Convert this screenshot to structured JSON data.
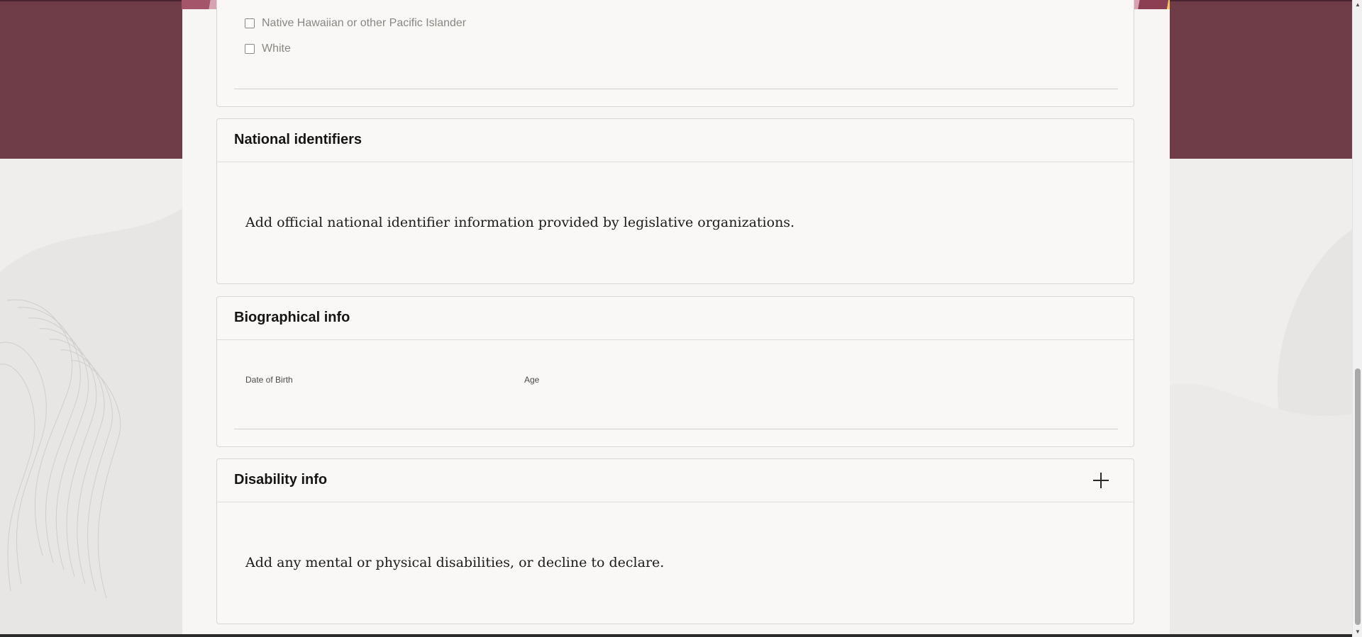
{
  "race_options": [
    {
      "label": "Native Hawaiian or other Pacific Islander",
      "checked": false
    },
    {
      "label": "White",
      "checked": false
    }
  ],
  "national_identifiers": {
    "title": "National identifiers",
    "description": "Add official national identifier information provided by legislative organizations."
  },
  "biographical_info": {
    "title": "Biographical info",
    "date_of_birth_label": "Date of Birth",
    "age_label": "Age"
  },
  "disability_info": {
    "title": "Disability info",
    "description": "Add any mental or physical disabilities, or decline to declare.",
    "add_icon": "plus-icon"
  },
  "colors": {
    "header_band": "#6f3d48",
    "page_background": "#efeeec",
    "card_background": "#f9f8f6"
  }
}
